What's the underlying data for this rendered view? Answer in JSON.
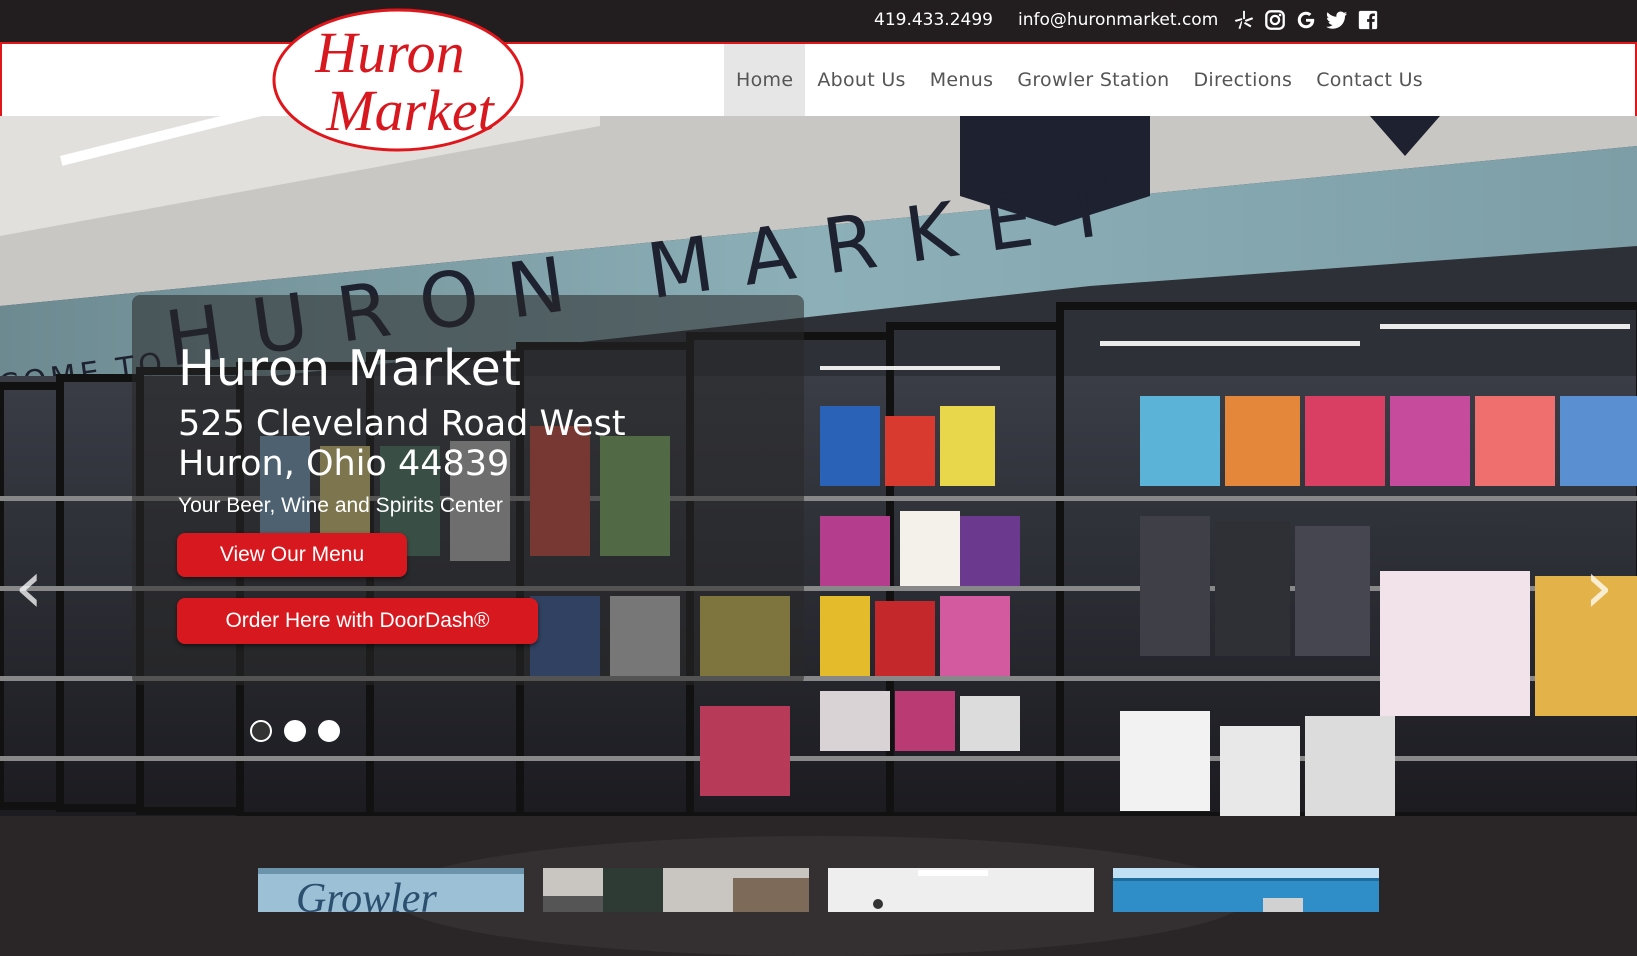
{
  "contact": {
    "phone": "419.433.2499",
    "email": "info@huronmarket.com"
  },
  "social": [
    "yelp-icon",
    "instagram-icon",
    "google-icon",
    "twitter-icon",
    "facebook-icon"
  ],
  "logo": {
    "line1": "Huron",
    "line2": "Market"
  },
  "nav": {
    "items": [
      "Home",
      "About Us",
      "Menus",
      "Growler Station",
      "Directions",
      "Contact Us"
    ],
    "active": "Home"
  },
  "hero": {
    "title": "Huron Market",
    "address_line1": "525 Cleveland Road West",
    "address_line2": "Huron, Ohio 44839",
    "tagline": "Your Beer, Wine and Spirits Center",
    "button_menu": "View Our Menu",
    "button_doordash": "Order Here with DoorDash®",
    "slides": 3,
    "active_slide": 1,
    "sign_text": "COME TO HURON MARKET",
    "prev_arrow": "‹",
    "next_arrow": "›"
  },
  "thumbnails": {
    "first_label": "Growler"
  },
  "colors": {
    "brand_red": "#d7191f",
    "topbar": "#221e20",
    "nav_border": "#e0161b"
  }
}
